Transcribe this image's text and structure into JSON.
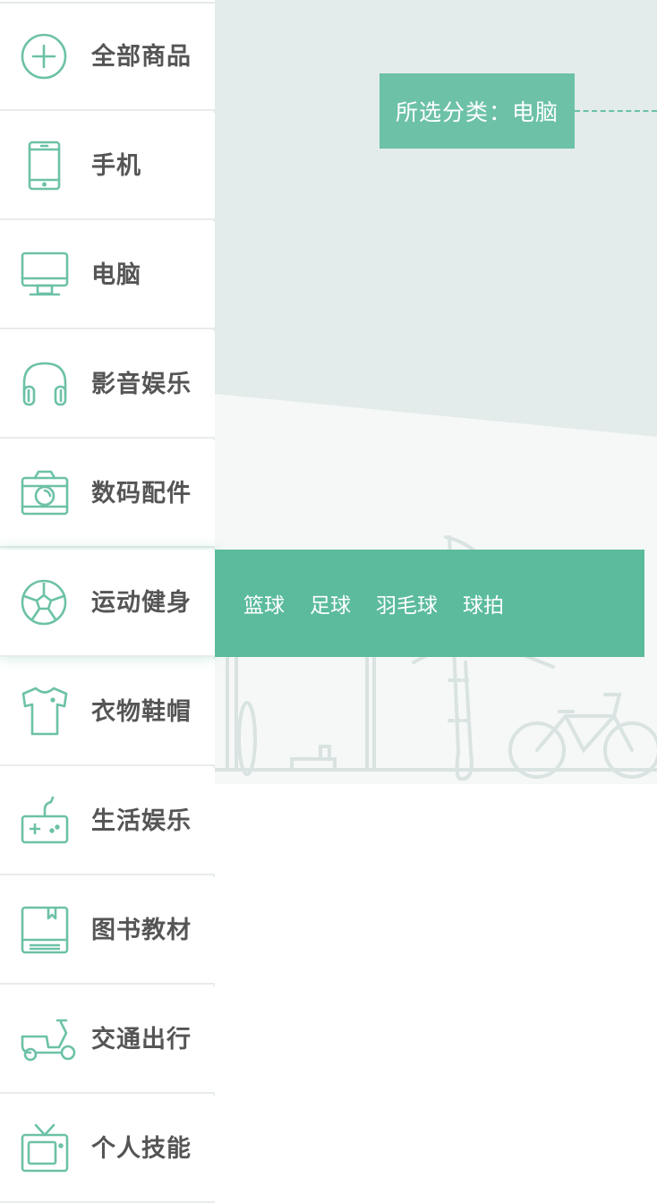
{
  "banner": {
    "selected_label": "所选分类：电脑"
  },
  "sidebar": {
    "items": [
      {
        "label": "全部商品",
        "icon": "plus-circle-icon"
      },
      {
        "label": "手机",
        "icon": "phone-icon"
      },
      {
        "label": "电脑",
        "icon": "monitor-icon"
      },
      {
        "label": "影音娱乐",
        "icon": "headphones-icon"
      },
      {
        "label": "数码配件",
        "icon": "camera-icon"
      },
      {
        "label": "运动健身",
        "icon": "soccer-ball-icon"
      },
      {
        "label": "衣物鞋帽",
        "icon": "tshirt-icon"
      },
      {
        "label": "生活娱乐",
        "icon": "gamepad-icon"
      },
      {
        "label": "图书教材",
        "icon": "book-icon"
      },
      {
        "label": "交通出行",
        "icon": "scooter-icon"
      },
      {
        "label": "个人技能",
        "icon": "tv-icon"
      }
    ],
    "active_index": 5
  },
  "submenu": {
    "items": [
      "篮球",
      "足球",
      "羽毛球",
      "球拍"
    ]
  },
  "colors": {
    "accent": "#5cbb9d",
    "tag": "#6cc1a7",
    "text": "#555555"
  }
}
